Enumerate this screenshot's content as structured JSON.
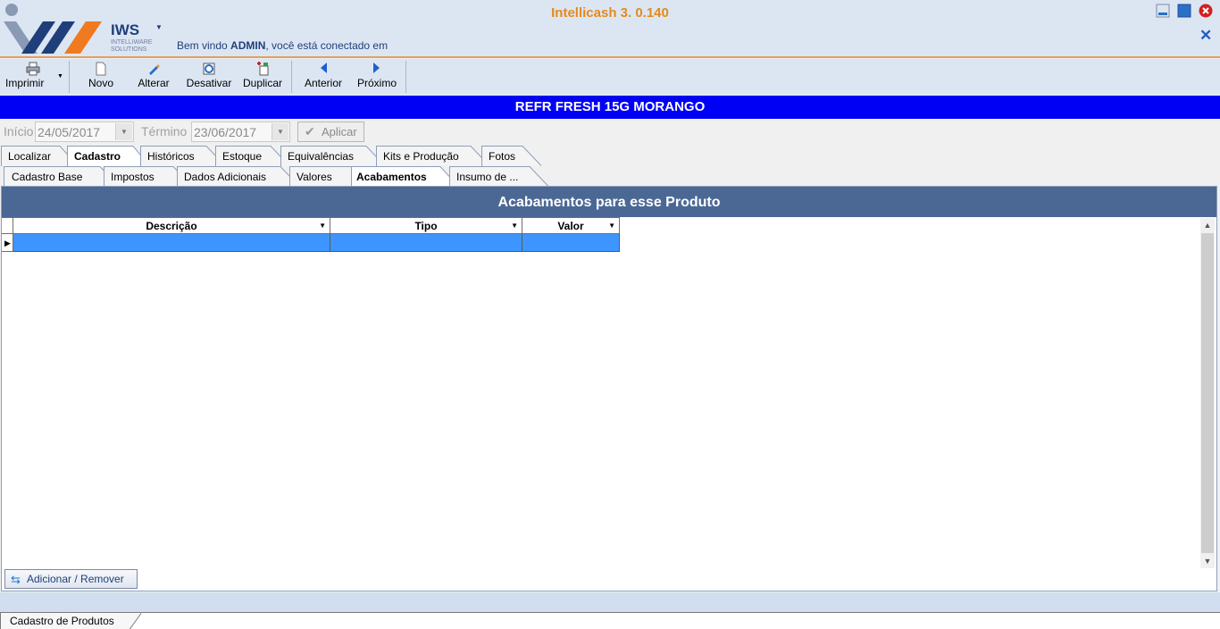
{
  "header": {
    "app_title": "Intellicash 3. 0.140",
    "logo_name": "IWS",
    "logo_sub_1": "INTELLIWARE",
    "logo_sub_2": "SOLUTIONS",
    "welcome_prefix": "Bem vindo ",
    "welcome_user": "ADMIN",
    "welcome_suffix": ", você está conectado em"
  },
  "toolbar": {
    "print_label": "Imprimir",
    "new_label": "Novo",
    "edit_label": "Alterar",
    "deactivate_label": "Desativar",
    "duplicate_label": "Duplicar",
    "previous_label": "Anterior",
    "next_label": "Próximo"
  },
  "product": {
    "name": "REFR FRESH 15G MORANGO"
  },
  "filters": {
    "start_label": "Início",
    "start_value": "24/05/2017",
    "end_label": "Término",
    "end_value": "23/06/2017",
    "apply_label": "Aplicar"
  },
  "tabs_main": [
    "Localizar",
    "Cadastro",
    "Históricos",
    "Estoque",
    "Equivalências",
    "Kits e Produção",
    "Fotos"
  ],
  "tabs_main_active": "Cadastro",
  "tabs_sub": [
    "Cadastro Base",
    "Impostos",
    "Dados Adicionais",
    "Valores",
    "Acabamentos",
    "Insumo de ..."
  ],
  "tabs_sub_active": "Acabamentos",
  "panel": {
    "title": "Acabamentos para esse Produto",
    "columns": [
      "Descrição",
      "Tipo",
      "Valor"
    ],
    "rows": [
      [
        "",
        "",
        ""
      ]
    ],
    "add_remove_label": "Adicionar / Remover"
  },
  "doc_tab": {
    "label": "Cadastro de Produtos"
  },
  "colors": {
    "product_bar": "#0000f5",
    "panel_title": "#4b6895",
    "selected_row": "#3d95ff",
    "app_title": "#e58a1a"
  }
}
